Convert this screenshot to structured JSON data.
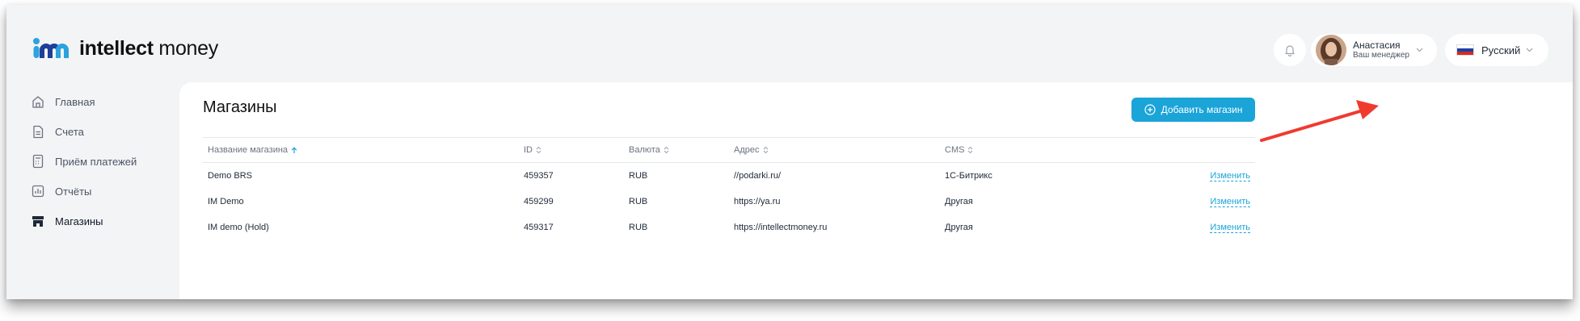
{
  "brand": {
    "name_bold": "intellect",
    "name_light": " money"
  },
  "header": {
    "user": {
      "name": "Анастасия",
      "role": "Ваш менеджер"
    },
    "language": {
      "label": "Русский"
    },
    "icons": [
      "bell-icon",
      "chevron-down-icon",
      "ru-flag-icon"
    ]
  },
  "sidebar": {
    "items": [
      {
        "label": "Главная",
        "icon": "home-icon",
        "active": false
      },
      {
        "label": "Счета",
        "icon": "document-icon",
        "active": false
      },
      {
        "label": "Приём платежей",
        "icon": "terminal-icon",
        "active": false
      },
      {
        "label": "Отчёты",
        "icon": "chart-icon",
        "active": false
      },
      {
        "label": "Магазины",
        "icon": "store-icon",
        "active": true
      }
    ]
  },
  "main": {
    "title": "Магазины",
    "add_button": "Добавить магазин",
    "table": {
      "columns": [
        "Название магазина",
        "ID",
        "Валюта",
        "Адрес",
        "CMS"
      ],
      "edit_label": "Изменить",
      "rows": [
        {
          "name": "Demo BRS",
          "id": "459357",
          "currency": "RUB",
          "address": "//podarki.ru/",
          "cms": "1С-Битрикс"
        },
        {
          "name": "IM Demo",
          "id": "459299",
          "currency": "RUB",
          "address": "https://ya.ru",
          "cms": "Другая"
        },
        {
          "name": "IM demo (Hold)",
          "id": "459317",
          "currency": "RUB",
          "address": "https://intellectmoney.ru",
          "cms": "Другая"
        }
      ]
    }
  },
  "colors": {
    "accent": "#1aa4d8",
    "annotation_arrow": "#f03a2e",
    "background": "#f3f4f6"
  }
}
